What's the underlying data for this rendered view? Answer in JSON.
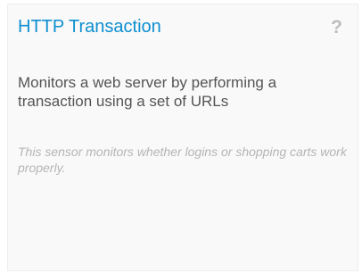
{
  "card": {
    "title": "HTTP Transaction",
    "help_glyph": "?",
    "description": "Monitors a web server by performing a transaction using a set of URLs",
    "note": "This sensor monitors whether logins or shopping carts work properly."
  },
  "colors": {
    "title": "#0d8fd0",
    "description": "#545454",
    "note": "#b5b5b5",
    "help_icon": "#bdbdbd",
    "card_background": "#f9f9f9"
  },
  "icons": {
    "help": "help-question-icon"
  }
}
